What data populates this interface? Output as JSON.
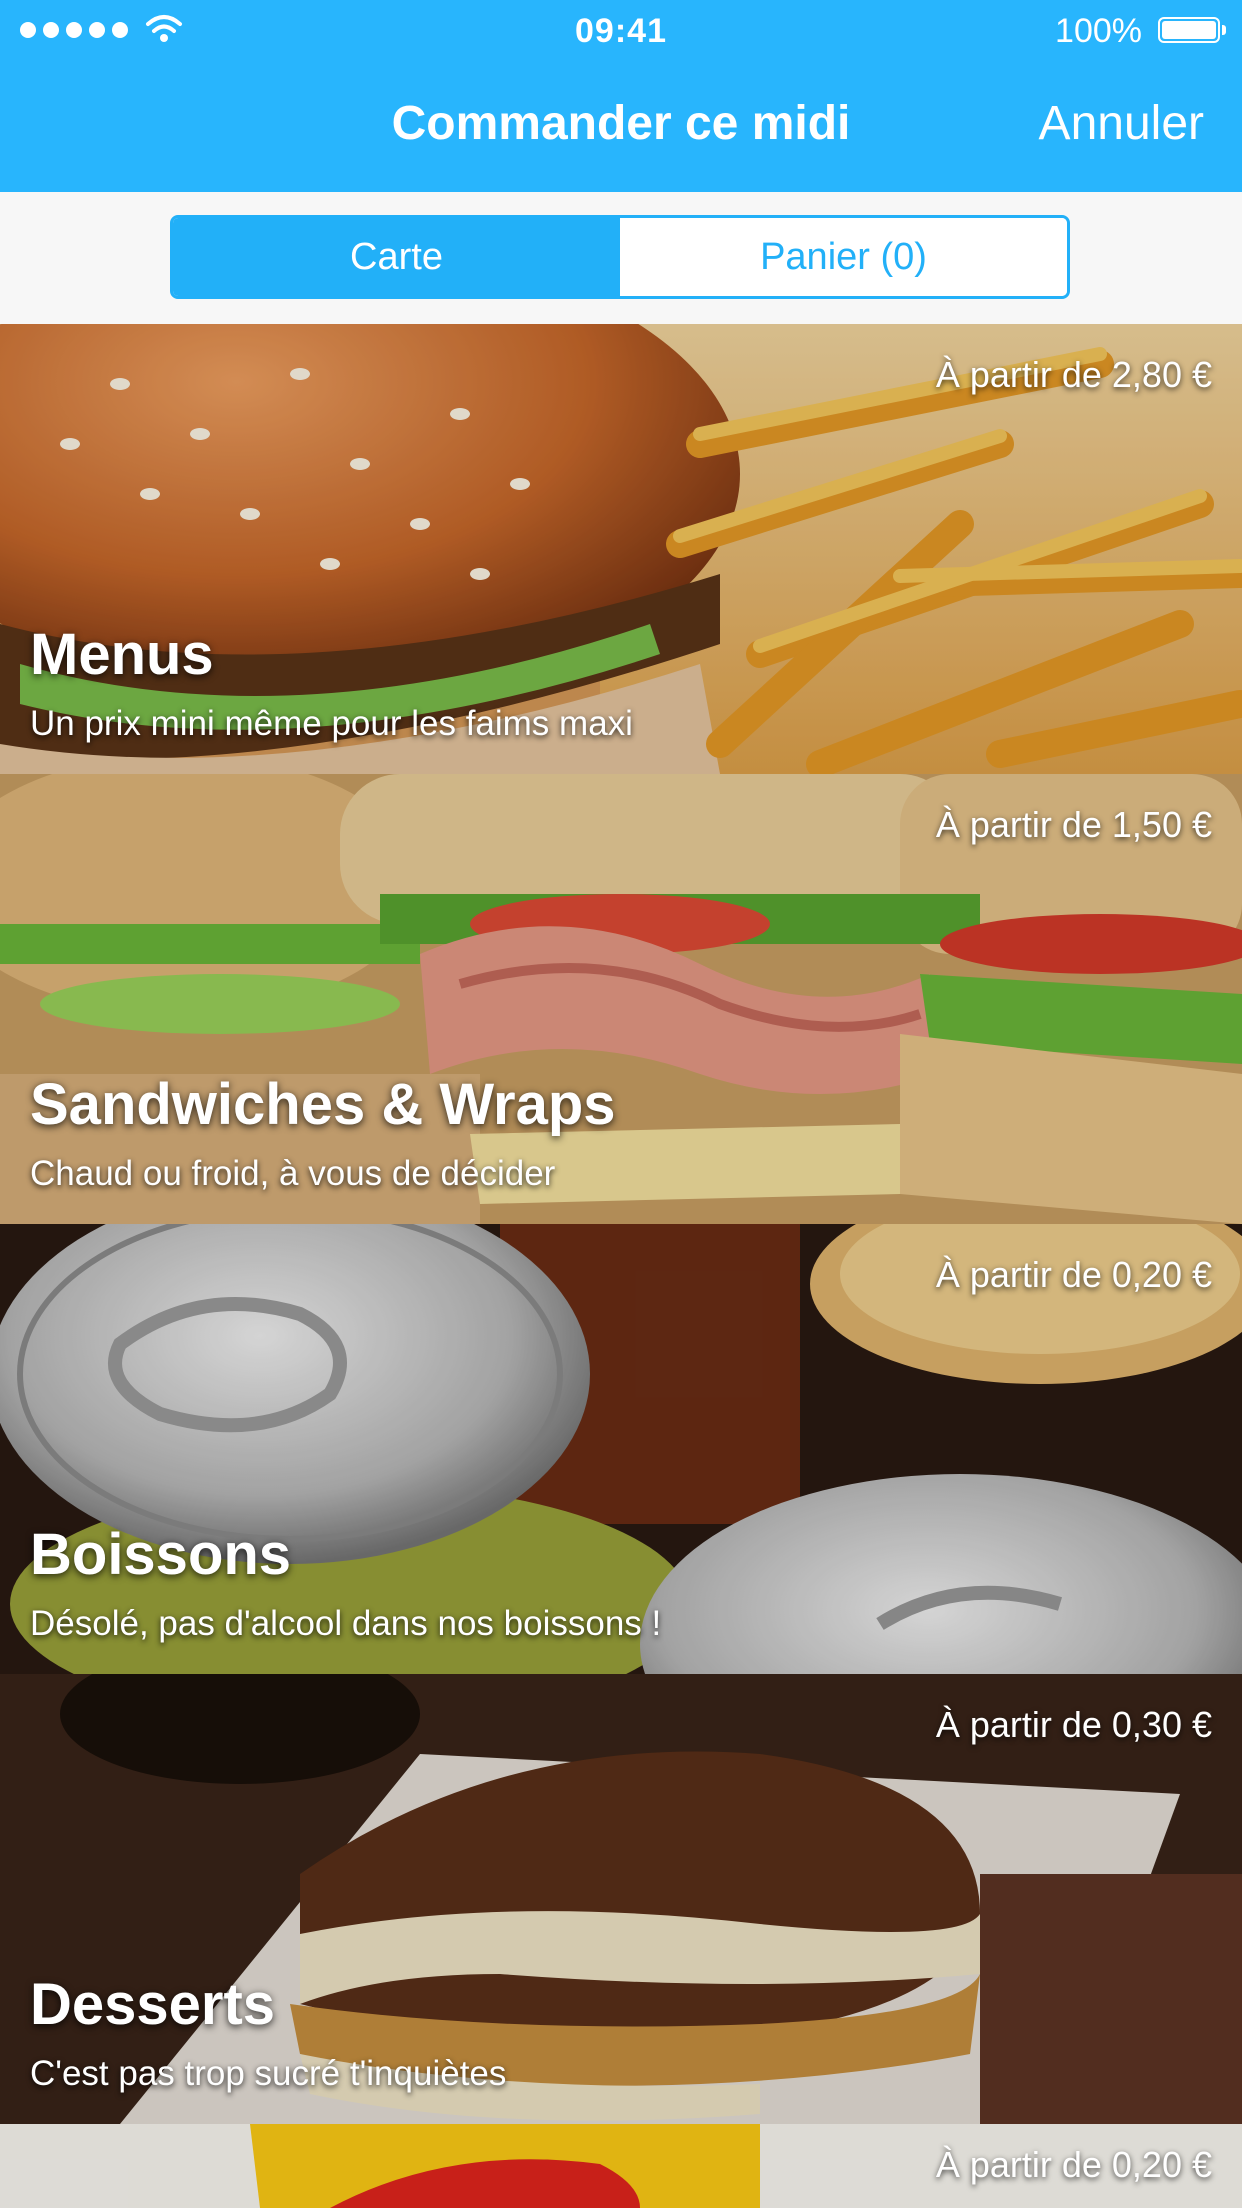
{
  "status_bar": {
    "time": "09:41",
    "battery": "100%"
  },
  "nav": {
    "title": "Commander ce midi",
    "cancel_label": "Annuler"
  },
  "segments": {
    "carte_label": "Carte",
    "panier_label": "Panier (0)"
  },
  "categories": [
    {
      "title": "Menus",
      "subtitle": "Un prix mini même pour les faims maxi",
      "price": "À partir de 2,80 €"
    },
    {
      "title": "Sandwiches & Wraps",
      "subtitle": "Chaud ou froid, à vous de décider",
      "price": "À partir de 1,50 €"
    },
    {
      "title": "Boissons",
      "subtitle": "Désolé, pas d'alcool dans nos boissons !",
      "price": "À partir de 0,20 €"
    },
    {
      "title": "Desserts",
      "subtitle": "C'est pas trop sucré t'inquiètes",
      "price": "À partir de 0,30 €"
    },
    {
      "price": "À partir de 0,20 €"
    }
  ],
  "colors": {
    "accent": "#28b5fd",
    "segment_accent": "#22b0f8"
  },
  "icons": [
    "signal-icon",
    "wifi-icon",
    "battery-icon"
  ]
}
